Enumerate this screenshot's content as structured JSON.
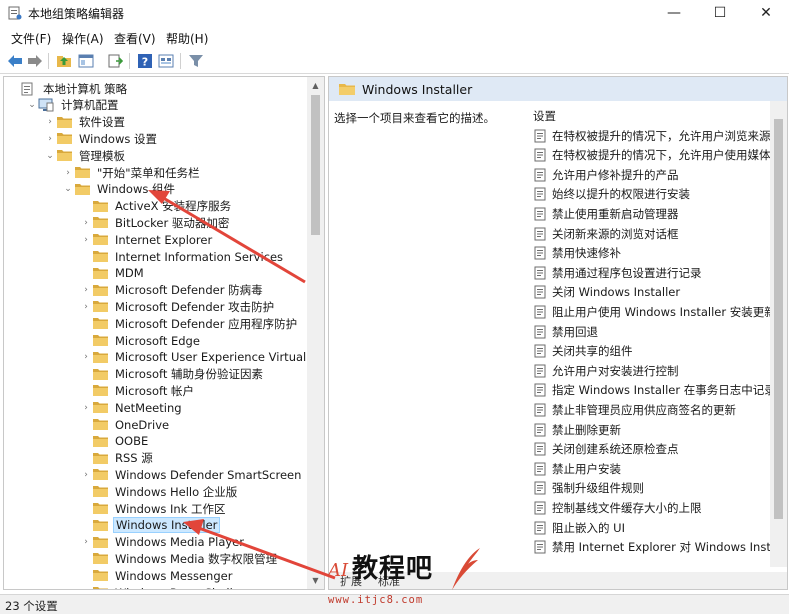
{
  "window": {
    "title": "本地组策略编辑器",
    "minimize_glyph": "—",
    "maximize_glyph": "☐",
    "close_glyph": "✕"
  },
  "menu": [
    "文件(F)",
    "操作(A)",
    "查看(V)",
    "帮助(H)"
  ],
  "toolbar": {
    "buttons": [
      "back-arrow-icon",
      "forward-arrow-icon",
      "up-folder-icon",
      "show-hide-tree-icon",
      "export-list-icon",
      "help-icon",
      "properties-icon",
      "filter-icon"
    ]
  },
  "tree": {
    "items": [
      {
        "label": "本地计算机 策略",
        "icon": "policy-doc-icon",
        "toggle": ""
      },
      {
        "label": "计算机配置",
        "icon": "computer-icon",
        "toggle": "⌄"
      },
      {
        "label": "软件设置",
        "icon": "folder-icon",
        "toggle": "›"
      },
      {
        "label": "Windows 设置",
        "icon": "folder-icon",
        "toggle": "›"
      },
      {
        "label": "管理模板",
        "icon": "folder-icon",
        "toggle": "⌄"
      },
      {
        "label": "\"开始\"菜单和任务栏",
        "icon": "folder-icon",
        "toggle": "›"
      },
      {
        "label": "Windows 组件",
        "icon": "folder-icon",
        "toggle": "⌄"
      },
      {
        "label": "ActiveX 安装程序服务",
        "icon": "folder-icon",
        "toggle": ""
      },
      {
        "label": "BitLocker 驱动器加密",
        "icon": "folder-icon",
        "toggle": "›"
      },
      {
        "label": "Internet Explorer",
        "icon": "folder-icon",
        "toggle": "›"
      },
      {
        "label": "Internet Information Services",
        "icon": "folder-icon",
        "toggle": ""
      },
      {
        "label": "MDM",
        "icon": "folder-icon",
        "toggle": ""
      },
      {
        "label": "Microsoft Defender 防病毒",
        "icon": "folder-icon",
        "toggle": "›"
      },
      {
        "label": "Microsoft Defender 攻击防护",
        "icon": "folder-icon",
        "toggle": "›"
      },
      {
        "label": "Microsoft Defender 应用程序防护",
        "icon": "folder-icon",
        "toggle": ""
      },
      {
        "label": "Microsoft Edge",
        "icon": "folder-icon",
        "toggle": ""
      },
      {
        "label": "Microsoft User Experience Virtualization",
        "icon": "folder-icon",
        "toggle": "›"
      },
      {
        "label": "Microsoft 辅助身份验证因素",
        "icon": "folder-icon",
        "toggle": ""
      },
      {
        "label": "Microsoft 帐户",
        "icon": "folder-icon",
        "toggle": ""
      },
      {
        "label": "NetMeeting",
        "icon": "folder-icon",
        "toggle": "›"
      },
      {
        "label": "OneDrive",
        "icon": "folder-icon",
        "toggle": ""
      },
      {
        "label": "OOBE",
        "icon": "folder-icon",
        "toggle": ""
      },
      {
        "label": "RSS 源",
        "icon": "folder-icon",
        "toggle": ""
      },
      {
        "label": "Windows Defender SmartScreen",
        "icon": "folder-icon",
        "toggle": "›"
      },
      {
        "label": "Windows Hello 企业版",
        "icon": "folder-icon",
        "toggle": ""
      },
      {
        "label": "Windows Ink 工作区",
        "icon": "folder-icon",
        "toggle": ""
      },
      {
        "label": "Windows Installer",
        "icon": "folder-icon",
        "toggle": "",
        "selected": true
      },
      {
        "label": "Windows Media Player",
        "icon": "folder-icon",
        "toggle": "›"
      },
      {
        "label": "Windows Media 数字权限管理",
        "icon": "folder-icon",
        "toggle": ""
      },
      {
        "label": "Windows Messenger",
        "icon": "folder-icon",
        "toggle": ""
      },
      {
        "label": "Windows PowerShell",
        "icon": "folder-icon",
        "toggle": ""
      }
    ]
  },
  "detail": {
    "header_title": "Windows Installer",
    "description": "选择一个项目来查看它的描述。",
    "column_label": "设置",
    "settings": [
      "在特权被提升的情况下，允许用户浏览来源",
      "在特权被提升的情况下，允许用户使用媒体源",
      "允许用户修补提升的产品",
      "始终以提升的权限进行安装",
      "禁止使用重新启动管理器",
      "关闭新来源的浏览对话框",
      "禁用快速修补",
      "禁用通过程序包设置进行记录",
      "关闭 Windows Installer",
      "阻止用户使用 Windows Installer 安装更新和升级",
      "禁用回退",
      "关闭共享的组件",
      "允许用户对安装进行控制",
      "指定 Windows Installer 在事务日志中记录的等待时间",
      "禁止非管理员应用供应商签名的更新",
      "禁止删除更新",
      "关闭创建系统还原检查点",
      "禁止用户安装",
      "强制升级组件规则",
      "控制基线文件缓存大小的上限",
      "阻止嵌入的 UI",
      "禁用 Internet Explorer 对 Windows Installer 脚本的安全提示"
    ],
    "tabs": [
      "扩展",
      "标准"
    ]
  },
  "status": {
    "text": "23 个设置"
  },
  "watermark": {
    "brand": "教程吧",
    "prefix": "AI",
    "url": "www.itjc8.com"
  },
  "colors": {
    "folder": "#e8b84a",
    "selection": "#cce8ff",
    "header_bg": "#dfe9f5",
    "arrow": "#e2453a"
  }
}
